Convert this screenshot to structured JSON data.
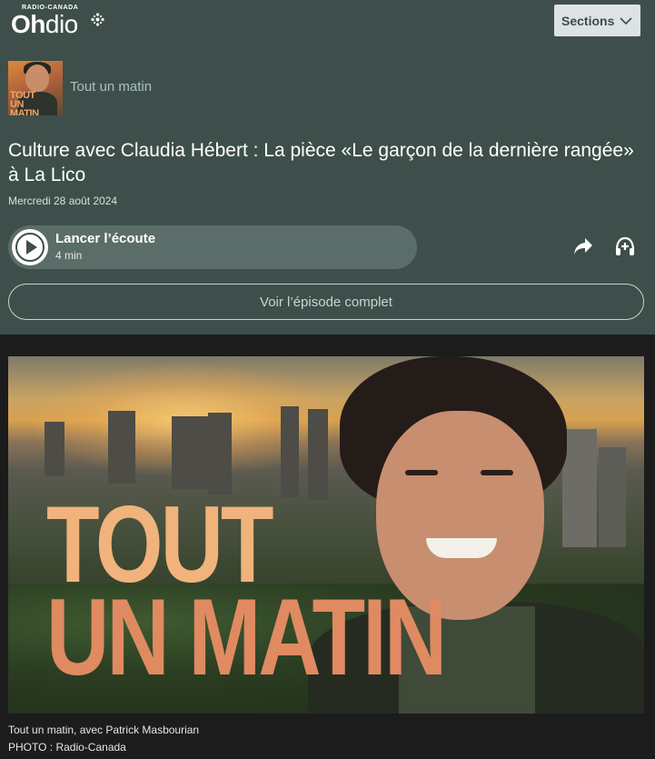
{
  "header": {
    "brand_top": "RADIO-CANADA",
    "brand_oh": "Oh",
    "brand_dio": "dio",
    "sections_label": "Sections"
  },
  "episode": {
    "show_name": "Tout un matin",
    "thumb_text_1": "TOUT",
    "thumb_text_2": "UN MATIN",
    "title": "Culture avec Claudia Hébert : La pièce «Le garçon de la dernière rangée» à La Lico",
    "date": "Mercredi 28 août 2024",
    "play_label": "Lancer l’écoute",
    "duration": "4 min",
    "full_episode_label": "Voir l’épisode complet"
  },
  "hero": {
    "line1": "TOUT",
    "line2": "UN MATIN",
    "caption": "Tout un matin, avec Patrick Masbourian",
    "credit": "PHOTO : Radio-Canada"
  },
  "icons": {
    "share": "share-icon",
    "listen_later": "listen-later-icon",
    "play": "play-icon",
    "chevron": "chevron-down-icon",
    "gem": "radio-canada-gem-icon"
  },
  "colors": {
    "header_bg": "#3e4f4b",
    "page_bg": "#1c1c1c",
    "player_bg": "#5b6d69",
    "accent_text": "#a9c2bd"
  }
}
